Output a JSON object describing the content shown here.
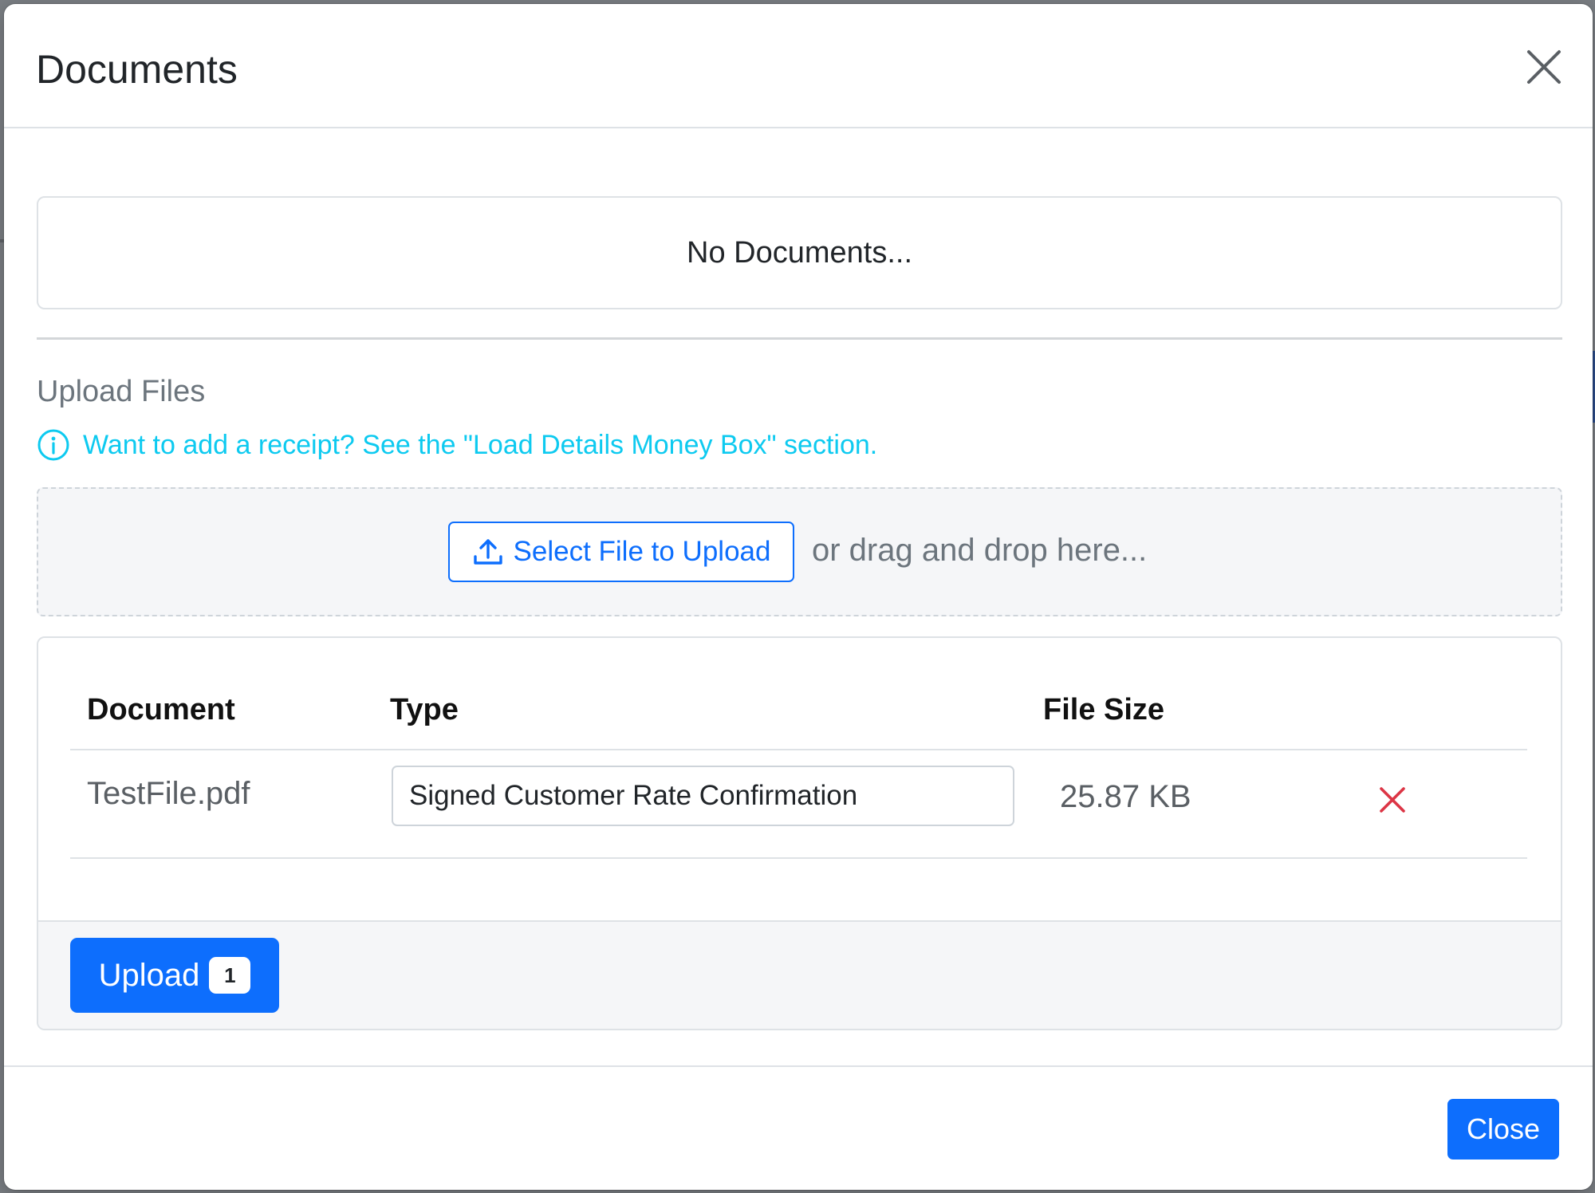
{
  "modal": {
    "title": "Documents",
    "close_icon": "close-icon"
  },
  "documents": {
    "empty_text": "No Documents..."
  },
  "upload": {
    "heading": "Upload Files",
    "info_text": "Want to add a receipt? See the \"Load Details Money Box\" section.",
    "select_button_label": "Select File to Upload",
    "drag_text": "or drag and drop here..."
  },
  "file_table": {
    "columns": [
      "Document",
      "Type",
      "File Size"
    ],
    "rows": [
      {
        "document": "TestFile.pdf",
        "type": "Signed Customer Rate Confirmation",
        "file_size": "25.87 KB"
      }
    ]
  },
  "upload_button": {
    "label": "Upload",
    "count": "1"
  },
  "footer": {
    "close_label": "Close"
  },
  "colors": {
    "primary": "#0d6efd",
    "info": "#0dcaf0",
    "danger": "#dc3545",
    "muted": "#6c757d"
  }
}
